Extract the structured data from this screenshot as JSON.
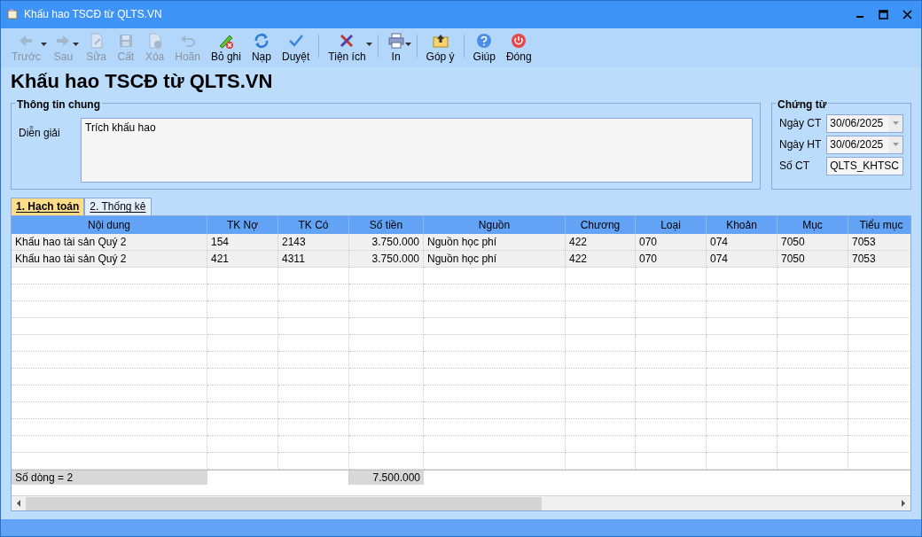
{
  "window": {
    "title": "Khấu hao TSCĐ từ QLTS.VN"
  },
  "toolbar": [
    {
      "label": "Trước",
      "disabled": true,
      "dropdown": true
    },
    {
      "label": "Sau",
      "disabled": true,
      "dropdown": true
    },
    {
      "label": "Sửa",
      "disabled": true,
      "dropdown": false
    },
    {
      "label": "Cất",
      "disabled": true,
      "dropdown": false
    },
    {
      "label": "Xóa",
      "disabled": true,
      "dropdown": false
    },
    {
      "label": "Hoãn",
      "disabled": true,
      "dropdown": false
    },
    {
      "label": "Bỏ ghi",
      "disabled": false,
      "dropdown": false
    },
    {
      "label": "Nạp",
      "disabled": false,
      "dropdown": false
    },
    {
      "label": "Duyệt",
      "disabled": false,
      "dropdown": false
    },
    {
      "label": "Tiện ích",
      "disabled": false,
      "dropdown": true
    },
    {
      "label": "In",
      "disabled": false,
      "dropdown": true
    },
    {
      "label": "Góp ý",
      "disabled": false,
      "dropdown": false
    },
    {
      "label": "Giúp",
      "disabled": false,
      "dropdown": false
    },
    {
      "label": "Đóng",
      "disabled": false,
      "dropdown": false
    }
  ],
  "heading": "Khấu hao TSCĐ từ QLTS.VN",
  "general": {
    "legend": "Thông tin chung",
    "label": "Diễn giải",
    "value": "Trích khấu hao"
  },
  "voucher": {
    "legend": "Chứng từ",
    "fields": [
      {
        "label": "Ngày CT",
        "value": "30/06/2025",
        "kind": "date"
      },
      {
        "label": "Ngày HT",
        "value": "30/06/2025",
        "kind": "date"
      },
      {
        "label": "Số CT",
        "value": "QLTS_KHTSC",
        "kind": "text"
      }
    ]
  },
  "tabs": [
    {
      "label": "1. Hạch toán",
      "selected": true
    },
    {
      "label": "2. Thống kê",
      "selected": false
    }
  ],
  "table": {
    "columns": [
      "Nội dung",
      "TK Nợ",
      "TK Có",
      "Số tiền",
      "Nguồn",
      "Chương",
      "Loại",
      "Khoản",
      "Mục",
      "Tiểu mục"
    ],
    "rows": [
      [
        "Khấu hao tài sản Quý 2",
        "154",
        "2143",
        "3.750.000",
        "Nguồn học phí",
        "422",
        "070",
        "074",
        "7050",
        "7053"
      ],
      [
        "Khấu hao tài sản Quý 2",
        "421",
        "4311",
        "3.750.000",
        "Nguồn học phí",
        "422",
        "070",
        "074",
        "7050",
        "7053"
      ]
    ],
    "footer": {
      "count": "Số dòng = 2",
      "total": "7.500.000"
    }
  }
}
